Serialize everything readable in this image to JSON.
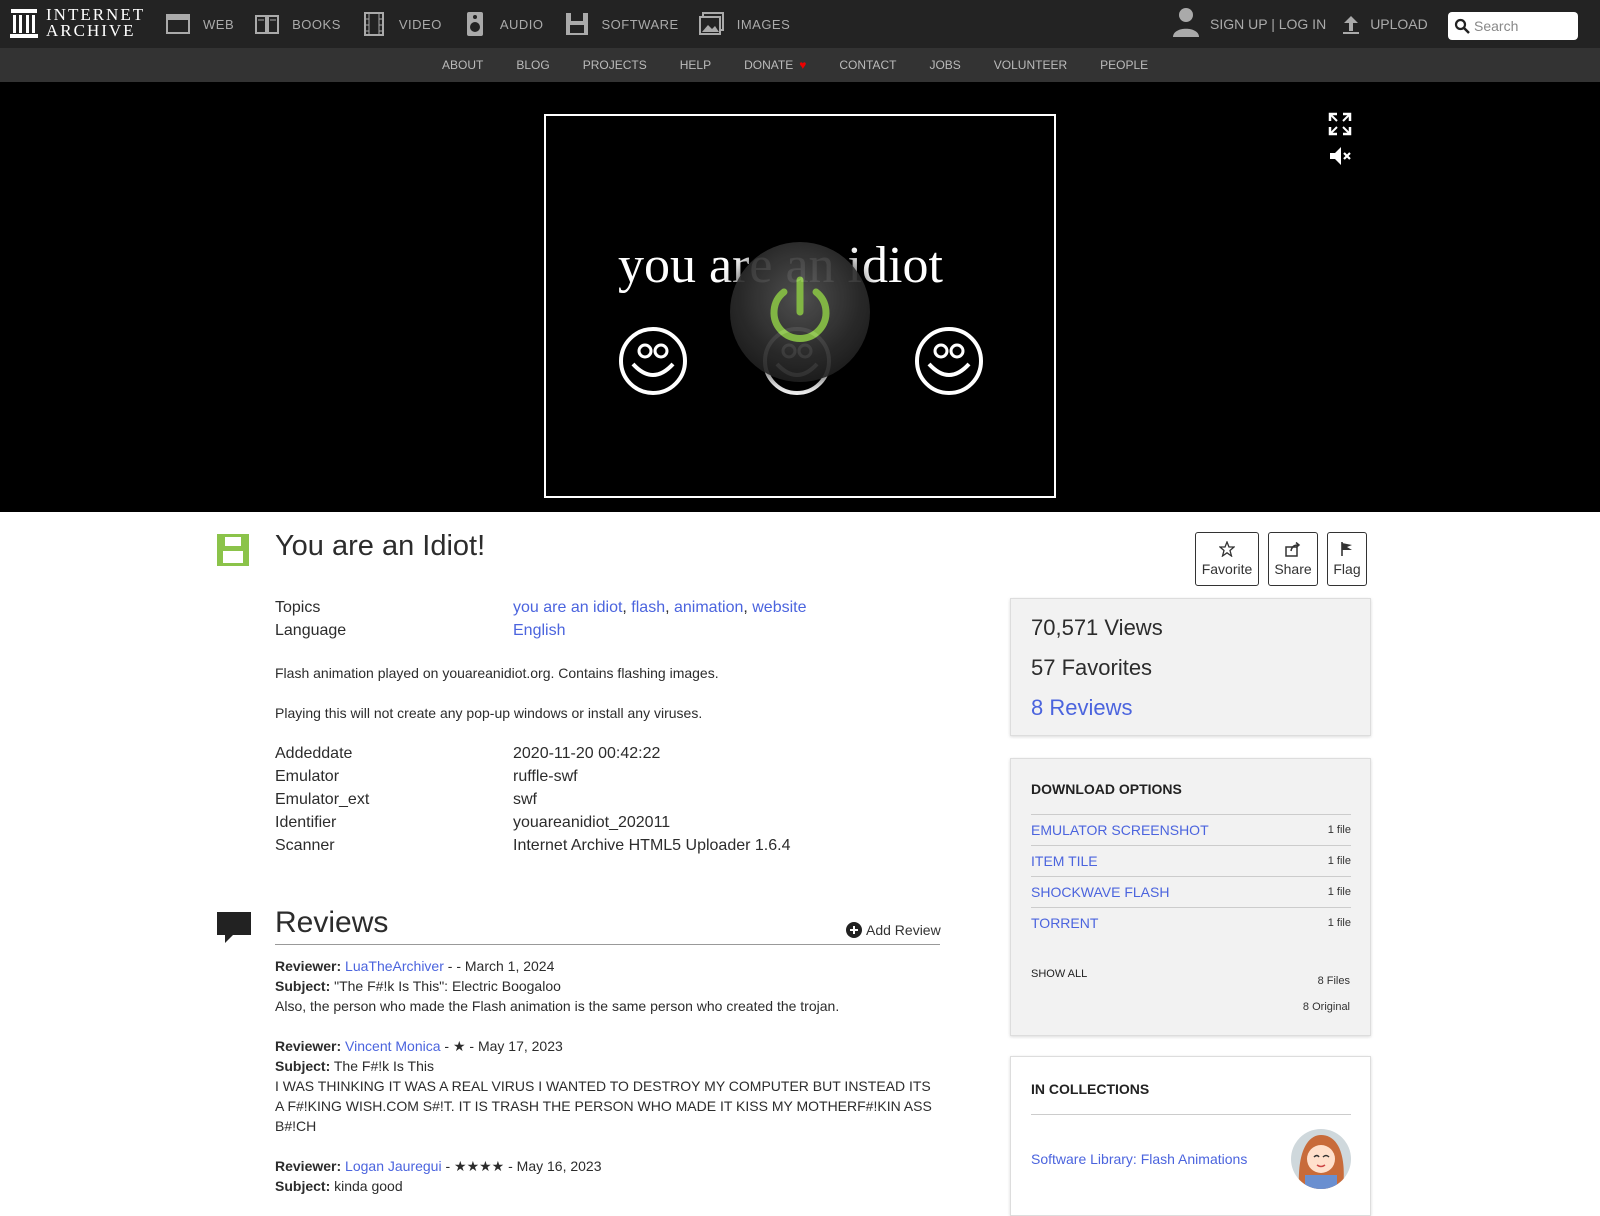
{
  "topnav": {
    "logo_line1": "INTERNET",
    "logo_line2": "ARCHIVE",
    "media": [
      {
        "label": "WEB",
        "icon": "web-icon"
      },
      {
        "label": "BOOKS",
        "icon": "books-icon"
      },
      {
        "label": "VIDEO",
        "icon": "film-icon"
      },
      {
        "label": "AUDIO",
        "icon": "speaker-icon"
      },
      {
        "label": "SOFTWARE",
        "icon": "floppy-icon"
      },
      {
        "label": "IMAGES",
        "icon": "image-icon"
      }
    ],
    "signup": "SIGN UP | LOG IN",
    "upload": "UPLOAD",
    "search_placeholder": "Search"
  },
  "subnav": [
    "ABOUT",
    "BLOG",
    "PROJECTS",
    "HELP",
    "DONATE",
    "CONTACT",
    "JOBS",
    "VOLUNTEER",
    "PEOPLE"
  ],
  "player": {
    "text": "you are an idiot"
  },
  "item": {
    "title": "You are an Idiot!",
    "actions": {
      "favorite": "Favorite",
      "share": "Share",
      "flag": "Flag"
    },
    "topics_label": "Topics",
    "topics": [
      "you are an idiot",
      "flash",
      "animation",
      "website"
    ],
    "language_label": "Language",
    "language": "English",
    "description": [
      "Flash animation played on youareanidiot.org. Contains flashing images.",
      "Playing this will not create any pop-up windows or install any viruses."
    ],
    "metadata": [
      {
        "key": "Addeddate",
        "value": "2020-11-20 00:42:22"
      },
      {
        "key": "Emulator",
        "value": "ruffle-swf"
      },
      {
        "key": "Emulator_ext",
        "value": "swf"
      },
      {
        "key": "Identifier",
        "value": "youareanidiot_202011"
      },
      {
        "key": "Scanner",
        "value": "Internet Archive HTML5 Uploader 1.6.4"
      }
    ]
  },
  "stats": {
    "views": "70,571 Views",
    "favorites": "57 Favorites",
    "reviews": "8 Reviews"
  },
  "downloads": {
    "heading": "DOWNLOAD OPTIONS",
    "items": [
      {
        "label": "EMULATOR SCREENSHOT",
        "count": "1 file"
      },
      {
        "label": "ITEM TILE",
        "count": "1 file"
      },
      {
        "label": "SHOCKWAVE FLASH",
        "count": "1 file"
      },
      {
        "label": "TORRENT",
        "count": "1 file"
      }
    ],
    "show_all": "SHOW ALL",
    "files_total": "8 Files",
    "original_total": "8 Original"
  },
  "collections": {
    "heading": "IN COLLECTIONS",
    "item": "Software Library: Flash Animations"
  },
  "reviews": {
    "title": "Reviews",
    "add_label": "Add Review",
    "reviewer_label": "Reviewer:",
    "subject_label": "Subject:",
    "list": [
      {
        "reviewer": "LuaTheArchiver",
        "meta": " - - March 1, 2024",
        "subject": "\"The F#!k Is This\": Electric Boogaloo",
        "body": "Also, the person who made the Flash animation is the same person who created the trojan."
      },
      {
        "reviewer": "Vincent Monica",
        "meta": " - ★ - May 17, 2023",
        "subject": "The F#!k Is This",
        "body": "I WAS THINKING IT WAS A REAL VIRUS I WANTED TO DESTROY MY COMPUTER BUT INSTEAD ITS A F#!KING WISH.COM S#!T. IT IS TRASH THE PERSON WHO MADE IT KISS MY MOTHERF#!KIN ASS B#!CH"
      },
      {
        "reviewer": "Logan Jauregui",
        "meta": " - ★★★★ - May 16, 2023",
        "subject": "kinda good",
        "body": ""
      }
    ]
  },
  "colors": {
    "topbar": "#232323",
    "subnav": "#333333",
    "link": "#4b64de",
    "software_green": "#8bc34a"
  }
}
